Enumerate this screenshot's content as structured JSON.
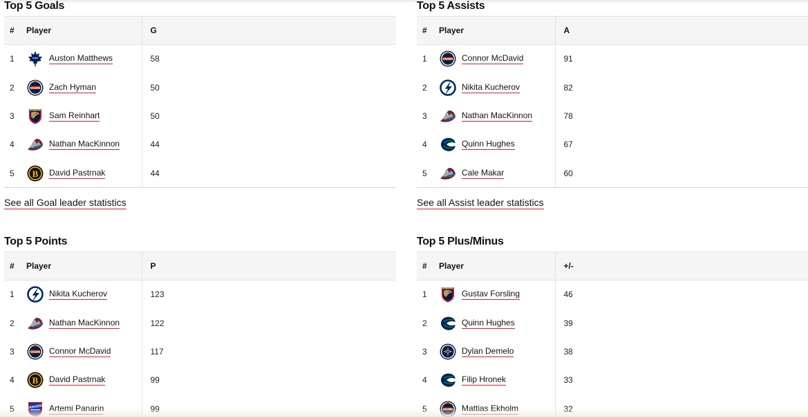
{
  "colors": {
    "accent_underline": "#d2202f",
    "header_bg": "#f5f5f5",
    "border": "#e2e2e2"
  },
  "goals": {
    "title": "Top 5 Goals",
    "headers": {
      "rank": "#",
      "player": "Player",
      "value": "G"
    },
    "rows": [
      {
        "rank": "1",
        "player": "Auston Matthews",
        "team_icon": "maple-leafs-logo-icon",
        "value": "58"
      },
      {
        "rank": "2",
        "player": "Zach Hyman",
        "team_icon": "oilers-logo-icon",
        "value": "50"
      },
      {
        "rank": "3",
        "player": "Sam Reinhart",
        "team_icon": "panthers-logo-icon",
        "value": "50"
      },
      {
        "rank": "4",
        "player": "Nathan MacKinnon",
        "team_icon": "avalanche-logo-icon",
        "value": "44"
      },
      {
        "rank": "5",
        "player": "David Pastrnak",
        "team_icon": "bruins-logo-icon",
        "value": "44"
      }
    ],
    "see_all": "See all Goal leader statistics"
  },
  "assists": {
    "title": "Top 5 Assists",
    "headers": {
      "rank": "#",
      "player": "Player",
      "value": "A"
    },
    "rows": [
      {
        "rank": "1",
        "player": "Connor McDavid",
        "team_icon": "oilers-logo-icon",
        "value": "91"
      },
      {
        "rank": "2",
        "player": "Nikita Kucherov",
        "team_icon": "lightning-logo-icon",
        "value": "82"
      },
      {
        "rank": "3",
        "player": "Nathan MacKinnon",
        "team_icon": "avalanche-logo-icon",
        "value": "78"
      },
      {
        "rank": "4",
        "player": "Quinn Hughes",
        "team_icon": "canucks-logo-icon",
        "value": "67"
      },
      {
        "rank": "5",
        "player": "Cale Makar",
        "team_icon": "avalanche-logo-icon",
        "value": "60"
      }
    ],
    "see_all": "See all Assist leader statistics"
  },
  "points": {
    "title": "Top 5 Points",
    "headers": {
      "rank": "#",
      "player": "Player",
      "value": "P"
    },
    "rows": [
      {
        "rank": "1",
        "player": "Nikita Kucherov",
        "team_icon": "lightning-logo-icon",
        "value": "123"
      },
      {
        "rank": "2",
        "player": "Nathan MacKinnon",
        "team_icon": "avalanche-logo-icon",
        "value": "122"
      },
      {
        "rank": "3",
        "player": "Connor McDavid",
        "team_icon": "oilers-logo-icon",
        "value": "117"
      },
      {
        "rank": "4",
        "player": "David Pastrnak",
        "team_icon": "bruins-logo-icon",
        "value": "99"
      },
      {
        "rank": "5",
        "player": "Artemi Panarin",
        "team_icon": "rangers-logo-icon",
        "value": "99"
      }
    ]
  },
  "plusminus": {
    "title": "Top 5 Plus/Minus",
    "headers": {
      "rank": "#",
      "player": "Player",
      "value": "+/-"
    },
    "rows": [
      {
        "rank": "1",
        "player": "Gustav Forsling",
        "team_icon": "panthers-logo-icon",
        "value": "46"
      },
      {
        "rank": "2",
        "player": "Quinn Hughes",
        "team_icon": "canucks-logo-icon",
        "value": "39"
      },
      {
        "rank": "3",
        "player": "Dylan Demelo",
        "team_icon": "jets-logo-icon",
        "value": "38"
      },
      {
        "rank": "4",
        "player": "Filip Hronek",
        "team_icon": "canucks-logo-icon",
        "value": "33"
      },
      {
        "rank": "5",
        "player": "Mattias Ekholm",
        "team_icon": "oilers-logo-icon",
        "value": "32"
      }
    ]
  }
}
